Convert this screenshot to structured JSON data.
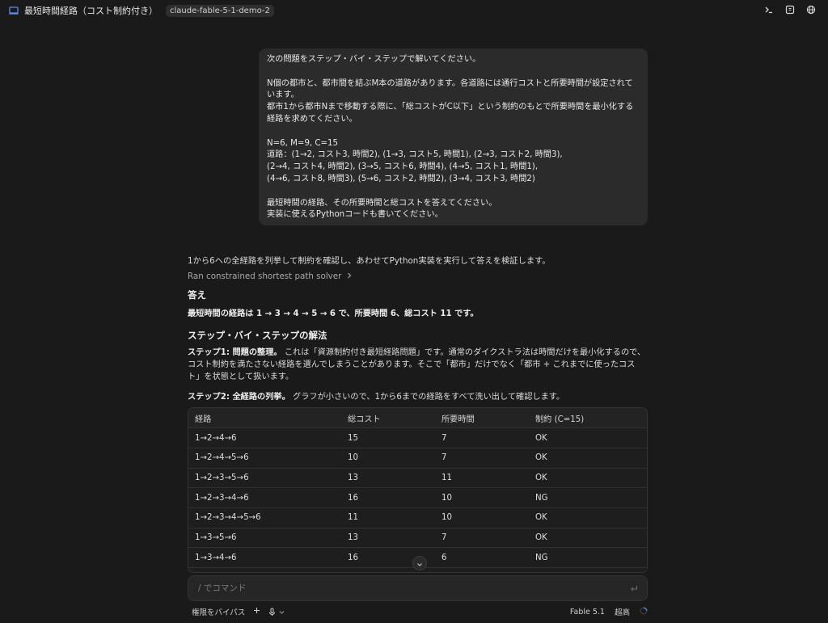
{
  "topbar": {
    "title": "最短時間経路（コスト制約付き）",
    "tag": "claude-fable-5-1-demo-2",
    "icons": [
      "laptop-icon",
      "terminal-icon",
      "panel-icon",
      "globe-icon"
    ]
  },
  "user_message": {
    "lines": [
      "次の問題をステップ・バイ・ステップで解いてください。",
      "",
      "N個の都市と、都市間を結ぶM本の道路があります。各道路には通行コストと所要時間が設定されています。",
      "都市1から都市Nまで移動する際に、「総コストがC以下」という制約のもとで所要時間を最小化する経路を求めてください。",
      "",
      "N=6, M=9, C=15",
      "道路：(1→2, コスト3, 時間2), (1→3, コスト5, 時間1), (2→3, コスト2, 時間3),",
      "(2→4, コスト4, 時間2), (3→5, コスト6, 時間4), (4→5, コスト1, 時間1),",
      "(4→6, コスト8, 時間3), (5→6, コスト2, 時間2), (3→4, コスト3, 時間2)",
      "",
      "最短時間の経路、その所要時間と総コストを答えてください。",
      "実装に使えるPythonコードも書いてください。"
    ]
  },
  "assistant": {
    "intro": "1から6への全経路を列挙して制約を確認し、あわせてPython実装を実行して答えを検証します。",
    "tool_run": "Ran constrained shortest path solver",
    "answer_heading": "答え",
    "answer_text": "最短時間の経路は 1 → 3 → 4 → 5 → 6 で、所要時間 6、総コスト 11 です。",
    "steps_heading": "ステップ・バイ・ステップの解法",
    "step1_label": "ステップ1: 問題の整理。",
    "step1_text": " これは「資源制約付き最短経路問題」です。通常のダイクストラ法は時間だけを最小化するので、コスト制約を満たさない経路を選んでしまうことがあります。そこで「都市」だけでなく「都市 + これまでに使ったコスト」を状態として扱います。",
    "step2_label": "ステップ2: 全経路の列挙。",
    "step2_text": " グラフが小さいので、1から6までの経路をすべて洗い出して確認します。"
  },
  "table": {
    "headers": [
      "経路",
      "総コスト",
      "所要時間",
      "制約 (C=15)"
    ],
    "rows": [
      [
        "1→2→4→6",
        "15",
        "7",
        "OK"
      ],
      [
        "1→2→4→5→6",
        "10",
        "7",
        "OK"
      ],
      [
        "1→2→3→5→6",
        "13",
        "11",
        "OK"
      ],
      [
        "1→2→3→4→6",
        "16",
        "10",
        "NG"
      ],
      [
        "1→2→3→4→5→6",
        "11",
        "10",
        "OK"
      ],
      [
        "1→3→5→6",
        "13",
        "7",
        "OK"
      ],
      [
        "1→3→4→6",
        "16",
        "6",
        "NG"
      ]
    ]
  },
  "input": {
    "placeholder": "/ でコマンド"
  },
  "bottombar": {
    "permission": "権限をバイパス",
    "model": "Fable 5.1",
    "effort": "超高"
  }
}
